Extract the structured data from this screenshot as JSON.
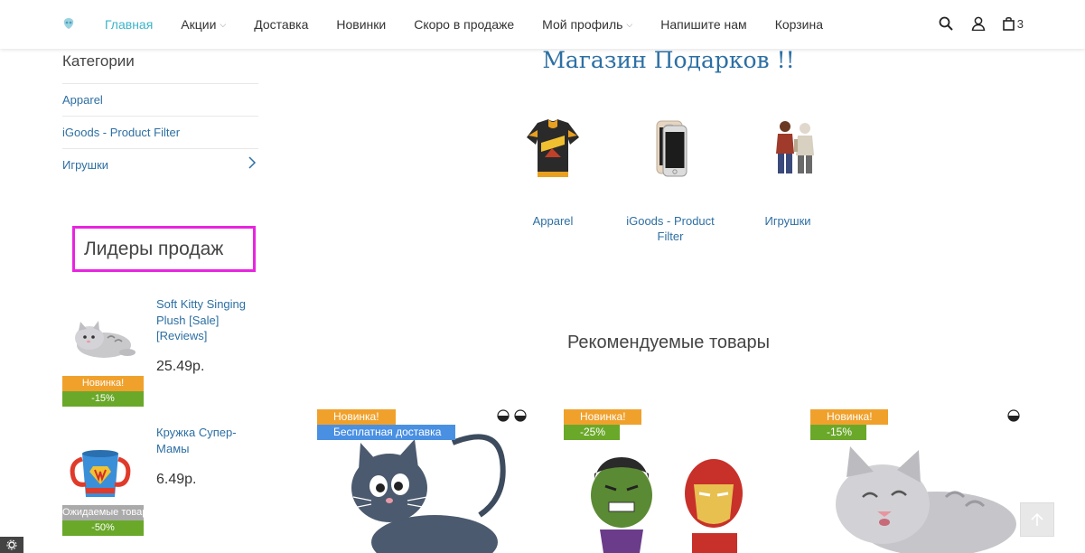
{
  "header": {
    "nav": [
      {
        "label": "Главная",
        "active": true,
        "dropdown": false
      },
      {
        "label": "Акции",
        "active": false,
        "dropdown": true
      },
      {
        "label": "Доставка",
        "active": false,
        "dropdown": false
      },
      {
        "label": "Новинки",
        "active": false,
        "dropdown": false
      },
      {
        "label": "Скоро в продаже",
        "active": false,
        "dropdown": false
      },
      {
        "label": "Мой профиль",
        "active": false,
        "dropdown": true
      },
      {
        "label": "Напишите нам",
        "active": false,
        "dropdown": false
      },
      {
        "label": "Корзина",
        "active": false,
        "dropdown": false
      }
    ],
    "cart_count": "3",
    "icons": [
      "search-icon",
      "user-icon",
      "bag-icon"
    ],
    "accent_color": "#3cb4c8"
  },
  "sidebar": {
    "categories_title": "Категории",
    "categories": [
      {
        "label": "Apparel"
      },
      {
        "label": "iGoods - Product Filter"
      },
      {
        "label": "Игрушки"
      }
    ],
    "bestsellers_title": "Лидеры продаж",
    "bestsellers": [
      {
        "title": "Soft Kitty Singing Plush [Sale] [Reviews]",
        "price": "25.49р.",
        "badge1": "Новинка!",
        "badge2": "-15%"
      },
      {
        "title": "Кружка Супер-Мамы",
        "price": "6.49р.",
        "badge1": "Ожидаемые товары",
        "badge2": "-50%"
      }
    ]
  },
  "main": {
    "shop_title": "Магазин Подарков !!",
    "category_cards": [
      {
        "label": "Apparel"
      },
      {
        "label": "iGoods - Product Filter"
      },
      {
        "label": "Игрушки"
      }
    ],
    "featured_title": "Рекомендуемые товары",
    "products": [
      {
        "badges": [
          "Новинка!",
          "Бесплатная доставка"
        ]
      },
      {
        "badges": [
          "Новинка!",
          "-25%"
        ]
      },
      {
        "badges": [
          "Новинка!",
          "-15%"
        ]
      }
    ]
  },
  "colors": {
    "link": "#2d6fa3",
    "badge_new": "#f0a12c",
    "badge_sale": "#6aa82a",
    "badge_shipping": "#4a90e2",
    "highlight": "#e824e0"
  }
}
